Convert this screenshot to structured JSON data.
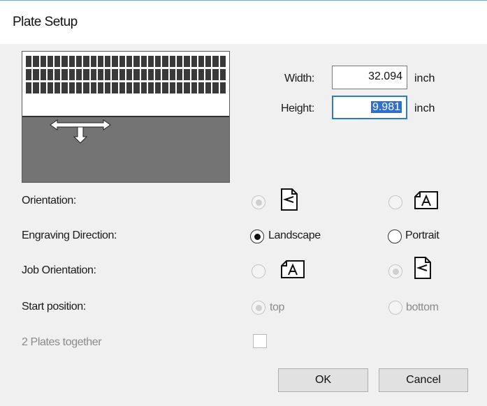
{
  "window": {
    "title": "Plate Setup"
  },
  "size": {
    "width_label": "Width:",
    "width_value": "32.094",
    "width_unit": "inch",
    "height_label": "Height:",
    "height_value_selected": "9.981",
    "height_unit": "inch"
  },
  "orientation": {
    "label": "Orientation:"
  },
  "engraving_direction": {
    "label": "Engraving Direction:",
    "option_landscape": "Landscape",
    "option_portrait": "Portrait",
    "selected": "Landscape"
  },
  "job_orientation": {
    "label": "Job Orientation:"
  },
  "start_position": {
    "label": "Start position:",
    "option_top": "top",
    "option_bottom": "bottom"
  },
  "plates_together": {
    "label": "2 Plates together",
    "checked": false
  },
  "buttons": {
    "ok": "OK",
    "cancel": "Cancel"
  },
  "icons": {
    "page_icon_left": "page-a-rotated-icon",
    "page_icon_up": "page-a-upright-icon"
  },
  "colors": {
    "selection": "#2f6fd0",
    "preview_bg": "#747474"
  }
}
